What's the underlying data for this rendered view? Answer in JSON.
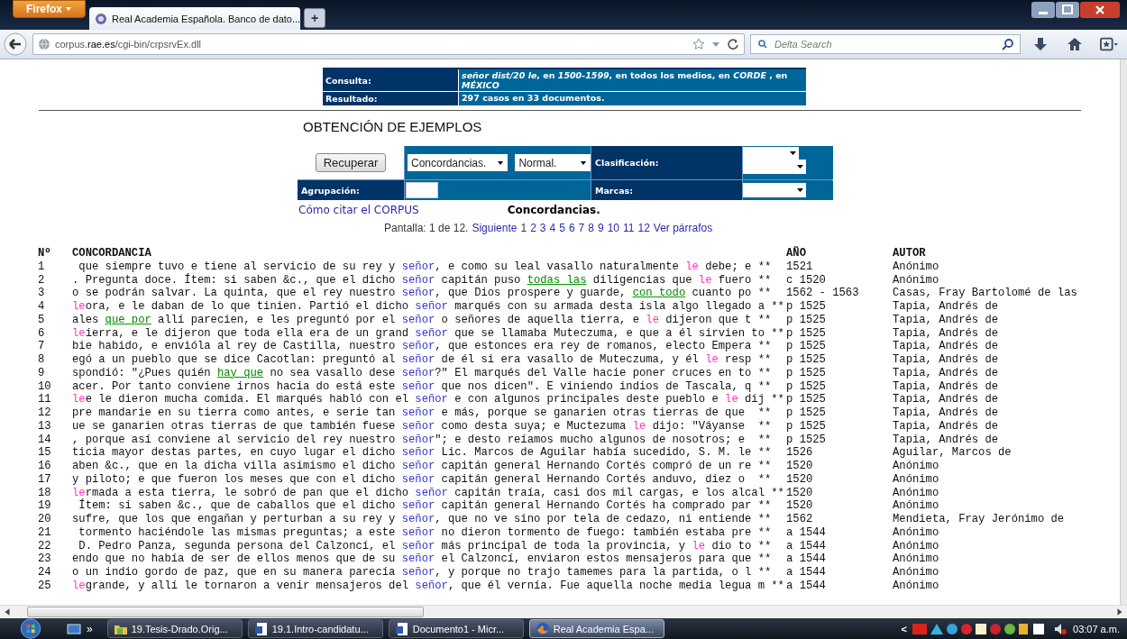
{
  "browser": {
    "menu_button": "Firefox",
    "tab_title": "Real Academia Española. Banco de dato...",
    "new_tab": "+",
    "url": "corpus.**rae.es**/cgi-bin/crpsrvEx.dll",
    "search_placeholder": "Delta Search"
  },
  "query": [
    {
      "label": "Consulta:",
      "value": "*señor dist/20 le*, en *1500-1599*, en todos los medios, en *CORDE* , en *MÉXICO*"
    },
    {
      "label": "Resultado:",
      "value": "297 casos en 33 documentos."
    }
  ],
  "section_title": "OBTENCIÓN DE EJEMPLOS",
  "form": {
    "button": "Recuperar",
    "view_select": "Concordancias.",
    "mode_select": "Normal.",
    "classification_label": "Clasificación:",
    "grouping_label": "Agrupación:",
    "marks_label": "Marcas:"
  },
  "cite_link": "Cómo citar el CORPUS",
  "view_heading": "Concordancias.",
  "pager": {
    "label": "Pantalla: 1 de 12.",
    "next": "Siguiente",
    "pages": [
      {
        "label": "1",
        "selected": true
      },
      {
        "label": "2",
        "selected": false
      },
      {
        "label": "3",
        "selected": false
      },
      {
        "label": "4",
        "selected": false
      },
      {
        "label": "5",
        "selected": false
      },
      {
        "label": "6",
        "selected": false
      },
      {
        "label": "7",
        "selected": false
      },
      {
        "label": "8",
        "selected": false
      },
      {
        "label": "9",
        "selected": false
      },
      {
        "label": "10",
        "selected": false
      },
      {
        "label": "11",
        "selected": false
      },
      {
        "label": "12",
        "selected": false
      }
    ],
    "paragraphs": "Ver párrafos"
  },
  "results": {
    "columns": [
      "Nº",
      "CONCORDANCIA",
      "AÑO",
      "AUTOR"
    ],
    "rows": [
      {
        "num": "1",
        "segments": [
          {
            "text": " que siempre tuvo e tiene al servicio de su rey y ",
            "kind": "plain"
          },
          {
            "text": "señor",
            "kind": "keyword"
          },
          {
            "text": ", e como su leal vasallo naturalmente ",
            "kind": "plain"
          },
          {
            "text": "le",
            "kind": "pronoun"
          },
          {
            "text": " debe; e **",
            "kind": "plain"
          }
        ],
        "year": "1521",
        "author": "Anónimo"
      },
      {
        "num": "2",
        "segments": [
          {
            "text": ". Pregunta doce. Ítem: si saben &c., que el dicho ",
            "kind": "plain"
          },
          {
            "text": "señor",
            "kind": "keyword"
          },
          {
            "text": " capitán puso ",
            "kind": "plain"
          },
          {
            "text": "todas las",
            "kind": "collocate"
          },
          {
            "text": " diligencias que ",
            "kind": "plain"
          },
          {
            "text": "le",
            "kind": "pronoun"
          },
          {
            "text": " fuero **",
            "kind": "plain"
          }
        ],
        "year": "c 1520",
        "author": "Anónimo"
      },
      {
        "num": "3",
        "segments": [
          {
            "text": "o se podrán salvar. La quinta, que el rey nuestro ",
            "kind": "plain"
          },
          {
            "text": "señor",
            "kind": "keyword"
          },
          {
            "text": ", que Dios prospere y guarde, ",
            "kind": "plain"
          },
          {
            "text": "con todo",
            "kind": "collocate"
          },
          {
            "text": " cuanto po **",
            "kind": "plain"
          }
        ],
        "year": "1562 - 1563",
        "author": "Casas, Fray Bartolomé de las"
      },
      {
        "num": "4",
        "segments": [
          {
            "text": "le",
            "kind": "pronoun"
          },
          {
            "text": "ora, e le daban de lo que tinien. Partió el dicho ",
            "kind": "plain"
          },
          {
            "text": "señor",
            "kind": "keyword"
          },
          {
            "text": " marqués con su armada desta isla algo llegado a **",
            "kind": "plain"
          }
        ],
        "year": "p 1525",
        "author": "Tapia, Andrés de"
      },
      {
        "num": "5",
        "segments": [
          {
            "text": "ales ",
            "kind": "plain"
          },
          {
            "text": "que por",
            "kind": "collocate"
          },
          {
            "text": " allí parecien, e les preguntó por el ",
            "kind": "plain"
          },
          {
            "text": "señor",
            "kind": "keyword"
          },
          {
            "text": " o señores de aquella tierra, e ",
            "kind": "plain"
          },
          {
            "text": "le",
            "kind": "pronoun"
          },
          {
            "text": " dijeron que t **",
            "kind": "plain"
          }
        ],
        "year": "p 1525",
        "author": "Tapia, Andrés de"
      },
      {
        "num": "6",
        "segments": [
          {
            "text": "le",
            "kind": "pronoun"
          },
          {
            "text": "ierra, e le dijeron que toda ella era de un grand ",
            "kind": "plain"
          },
          {
            "text": "señor",
            "kind": "keyword"
          },
          {
            "text": " que se llamaba Muteczuma, e que a él sirvien to **",
            "kind": "plain"
          }
        ],
        "year": "p 1525",
        "author": "Tapia, Andrés de"
      },
      {
        "num": "7",
        "segments": [
          {
            "text": "bie habido, e envióla al rey de Castilla, nuestro ",
            "kind": "plain"
          },
          {
            "text": "señor",
            "kind": "keyword"
          },
          {
            "text": ", que estonces era rey de romanos, electo Empera **",
            "kind": "plain"
          }
        ],
        "year": "p 1525",
        "author": "Tapia, Andrés de"
      },
      {
        "num": "8",
        "segments": [
          {
            "text": "egó a un pueblo que se dice Cacotlan: preguntó al ",
            "kind": "plain"
          },
          {
            "text": "señor",
            "kind": "keyword"
          },
          {
            "text": " de él si era vasallo de Muteczuma, y él ",
            "kind": "plain"
          },
          {
            "text": "le",
            "kind": "pronoun"
          },
          {
            "text": " resp **",
            "kind": "plain"
          }
        ],
        "year": "p 1525",
        "author": "Tapia, Andrés de"
      },
      {
        "num": "9",
        "segments": [
          {
            "text": "spondió: \"¿Pues quién ",
            "kind": "plain"
          },
          {
            "text": "hay que",
            "kind": "collocate"
          },
          {
            "text": " no sea vasallo dese ",
            "kind": "plain"
          },
          {
            "text": "señor",
            "kind": "keyword"
          },
          {
            "text": "?\" El marqués del Valle hacie poner cruces en to **",
            "kind": "plain"
          }
        ],
        "year": "p 1525",
        "author": "Tapia, Andrés de"
      },
      {
        "num": "10",
        "segments": [
          {
            "text": "acer. Por tanto conviene irnos hacia do está este ",
            "kind": "plain"
          },
          {
            "text": "señor",
            "kind": "keyword"
          },
          {
            "text": " que nos dicen\". E viniendo indios de Tascala, q **",
            "kind": "plain"
          }
        ],
        "year": "p 1525",
        "author": "Tapia, Andrés de"
      },
      {
        "num": "11",
        "segments": [
          {
            "text": "le",
            "kind": "pronoun"
          },
          {
            "text": "e le dieron mucha comida. El marqués habló con el ",
            "kind": "plain"
          },
          {
            "text": "señor",
            "kind": "keyword"
          },
          {
            "text": " e con algunos principales deste pueblo e ",
            "kind": "plain"
          },
          {
            "text": "le",
            "kind": "pronoun"
          },
          {
            "text": " dij **",
            "kind": "plain"
          }
        ],
        "year": "p 1525",
        "author": "Tapia, Andrés de"
      },
      {
        "num": "12",
        "segments": [
          {
            "text": "pre mandarie en su tierra como antes, e serie tan ",
            "kind": "plain"
          },
          {
            "text": "señor",
            "kind": "keyword"
          },
          {
            "text": " e más, porque se ganarien otras tierras de que  **",
            "kind": "plain"
          }
        ],
        "year": "p 1525",
        "author": "Tapia, Andrés de"
      },
      {
        "num": "13",
        "segments": [
          {
            "text": "ue se ganarien otras tierras de que también fuese ",
            "kind": "plain"
          },
          {
            "text": "señor",
            "kind": "keyword"
          },
          {
            "text": " como desta suya; e Muctezuma ",
            "kind": "plain"
          },
          {
            "text": "le",
            "kind": "pronoun"
          },
          {
            "text": " dijo: \"Váyanse  **",
            "kind": "plain"
          }
        ],
        "year": "p 1525",
        "author": "Tapia, Andrés de"
      },
      {
        "num": "14",
        "segments": [
          {
            "text": ", porque así conviene al servicio del rey nuestro ",
            "kind": "plain"
          },
          {
            "text": "señor",
            "kind": "keyword"
          },
          {
            "text": "\"; e desto reíamos mucho algunos de nosotros; e  **",
            "kind": "plain"
          }
        ],
        "year": "p 1525",
        "author": "Tapia, Andrés de"
      },
      {
        "num": "15",
        "segments": [
          {
            "text": "ticia mayor destas partes, en cuyo lugar el dicho ",
            "kind": "plain"
          },
          {
            "text": "señor",
            "kind": "keyword"
          },
          {
            "text": " Lic. Marcos de Aguilar había sucedido, S. M. le **",
            "kind": "plain"
          }
        ],
        "year": "1526",
        "author": "Aguilar, Marcos de"
      },
      {
        "num": "16",
        "segments": [
          {
            "text": "aben &c., que en la dicha villa asimismo el dicho ",
            "kind": "plain"
          },
          {
            "text": "señor",
            "kind": "keyword"
          },
          {
            "text": " capitán general Hernando Cortés compró de un re **",
            "kind": "plain"
          }
        ],
        "year": "1520",
        "author": "Anónimo"
      },
      {
        "num": "17",
        "segments": [
          {
            "text": "y piloto; e que fueron los meses que con el dicho ",
            "kind": "plain"
          },
          {
            "text": "señor",
            "kind": "keyword"
          },
          {
            "text": " capitán general Hernando Cortés anduvo, diez o  **",
            "kind": "plain"
          }
        ],
        "year": "1520",
        "author": "Anónimo"
      },
      {
        "num": "18",
        "segments": [
          {
            "text": "le",
            "kind": "pronoun"
          },
          {
            "text": "rmada a esta tierra, le sobró de pan que el dicho ",
            "kind": "plain"
          },
          {
            "text": "señor",
            "kind": "keyword"
          },
          {
            "text": " capitán traía, casi dos mil cargas, e los alcal **",
            "kind": "plain"
          }
        ],
        "year": "1520",
        "author": "Anónimo"
      },
      {
        "num": "19",
        "segments": [
          {
            "text": " Ítem: si saben &c., que de caballos que el dicho ",
            "kind": "plain"
          },
          {
            "text": "señor",
            "kind": "keyword"
          },
          {
            "text": " capitán general Hernando Cortés ha comprado par **",
            "kind": "plain"
          }
        ],
        "year": "1520",
        "author": "Anónimo"
      },
      {
        "num": "20",
        "segments": [
          {
            "text": "sufre, que los que engañan y perturban a su rey y ",
            "kind": "plain"
          },
          {
            "text": "señor",
            "kind": "keyword"
          },
          {
            "text": ", que no ve sino por tela de cedazo, ni entiende **",
            "kind": "plain"
          }
        ],
        "year": "1562",
        "author": "Mendieta, Fray Jerónimo de"
      },
      {
        "num": "21",
        "segments": [
          {
            "text": " tormento haciéndole las mismas preguntas; a este ",
            "kind": "plain"
          },
          {
            "text": "señor",
            "kind": "keyword"
          },
          {
            "text": " no dieron tormento de fuego: también estaba pre **",
            "kind": "plain"
          }
        ],
        "year": "a 1544",
        "author": "Anónimo"
      },
      {
        "num": "22",
        "segments": [
          {
            "text": " D. Pedro Panza, segunda persona del Calzoncí, el ",
            "kind": "plain"
          },
          {
            "text": "señor",
            "kind": "keyword"
          },
          {
            "text": " más principal de toda la provincia, y ",
            "kind": "plain"
          },
          {
            "text": "le",
            "kind": "pronoun"
          },
          {
            "text": " dio to **",
            "kind": "plain"
          }
        ],
        "year": "a 1544",
        "author": "Anónimo"
      },
      {
        "num": "23",
        "segments": [
          {
            "text": "endo que no había de ser de ellos menos que de su ",
            "kind": "plain"
          },
          {
            "text": "señor",
            "kind": "keyword"
          },
          {
            "text": " el Calzoncí, enviaron estos mensajeros para que **",
            "kind": "plain"
          }
        ],
        "year": "a 1544",
        "author": "Anónimo"
      },
      {
        "num": "24",
        "segments": [
          {
            "text": "o un indio gordo de paz, que en su manera parecía ",
            "kind": "plain"
          },
          {
            "text": "señor",
            "kind": "keyword"
          },
          {
            "text": ", y porque no trajo tamemes para la partida, o l **",
            "kind": "plain"
          }
        ],
        "year": "a 1544",
        "author": "Anónimo"
      },
      {
        "num": "25",
        "segments": [
          {
            "text": "le",
            "kind": "pronoun"
          },
          {
            "text": "grande, y allí le tornaron a venir mensajeros del ",
            "kind": "plain"
          },
          {
            "text": "señor",
            "kind": "keyword"
          },
          {
            "text": ", que él vernía. Fue aquella noche media legua m **",
            "kind": "plain"
          }
        ],
        "year": "a 1544",
        "author": "Anónimo"
      }
    ]
  },
  "taskbar": {
    "overflow": "»",
    "items": [
      {
        "label": "19.Tesis-Drado.Orig...",
        "kind": "folder",
        "selected": false
      },
      {
        "label": "19.1.Intro-candidatu...",
        "kind": "document",
        "selected": false
      },
      {
        "label": "Documento1 - Micr...",
        "kind": "document",
        "selected": false
      },
      {
        "label": "Real Academia Espa...",
        "kind": "browser",
        "selected": true
      }
    ],
    "tray_arrow": "<",
    "clock": "03:07 a.m."
  }
}
